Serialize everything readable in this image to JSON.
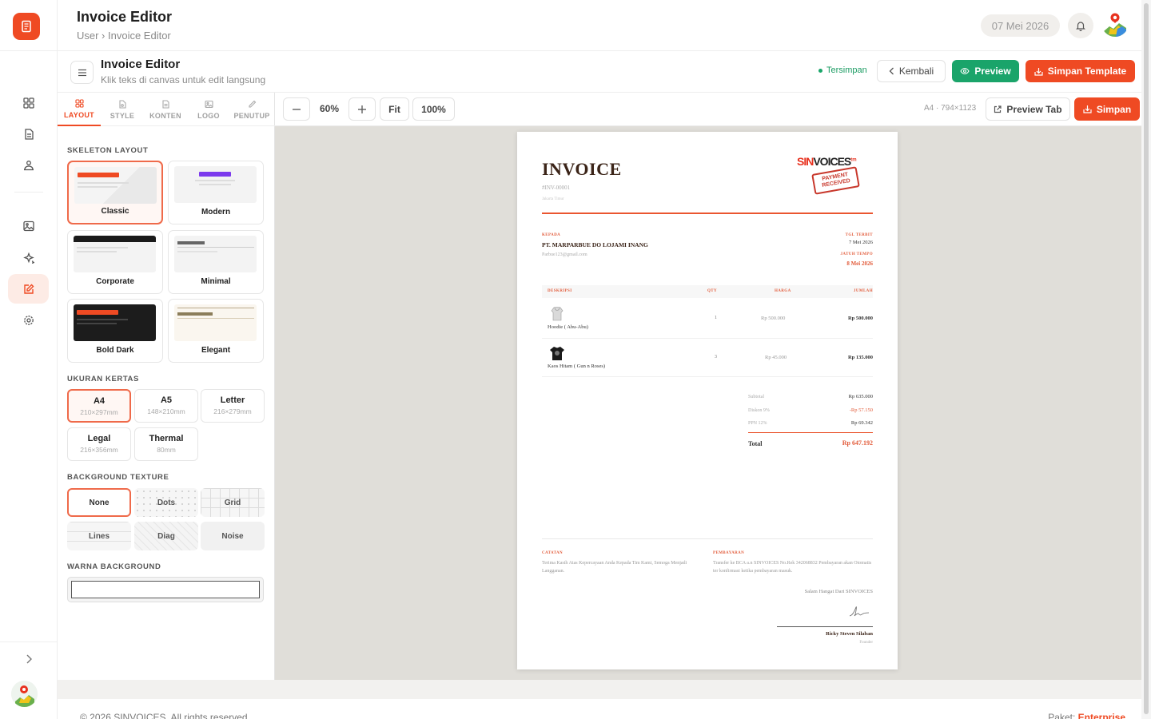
{
  "header": {
    "title": "Invoice Editor",
    "breadcrumb": "User › Invoice Editor",
    "date": "07 Mei 2026"
  },
  "editor": {
    "title": "Invoice Editor",
    "subtitle": "Klik teks di canvas untuk edit langsung",
    "saved_status": "Tersimpan",
    "back_label": "Kembali",
    "preview_label": "Preview",
    "save_template_label": "Simpan Template"
  },
  "tabs": [
    "LAYOUT",
    "STYLE",
    "KONTEN",
    "LOGO",
    "PENUTUP"
  ],
  "panel": {
    "skeleton_title": "SKELETON LAYOUT",
    "layouts": [
      "Classic",
      "Modern",
      "Corporate",
      "Minimal",
      "Bold Dark",
      "Elegant"
    ],
    "paper_title": "UKURAN KERTAS",
    "papers": [
      {
        "name": "A4",
        "size": "210×297mm"
      },
      {
        "name": "A5",
        "size": "148×210mm"
      },
      {
        "name": "Letter",
        "size": "216×279mm"
      },
      {
        "name": "Legal",
        "size": "216×356mm"
      },
      {
        "name": "Thermal",
        "size": "80mm"
      }
    ],
    "texture_title": "BACKGROUND TEXTURE",
    "textures": [
      "None",
      "Dots",
      "Grid",
      "Lines",
      "Diag",
      "Noise"
    ],
    "bgcolor_title": "WARNA BACKGROUND"
  },
  "canvas_toolbar": {
    "zoom": "60%",
    "fit_label": "Fit",
    "reset_label": "100%",
    "dimension": "A4 · 794×1123",
    "preview_tab_label": "Preview Tab",
    "save_label": "Simpan"
  },
  "invoice": {
    "title": "INVOICE",
    "number": "#INV-00001",
    "location": "Jakarta Timur",
    "brand_sin": "SIN",
    "brand_voices": "VOICES",
    "brand_tm": "tm",
    "stamp_line1": "PAYMENT",
    "stamp_line2": "RECEIVED",
    "to_label": "KEPADA",
    "to_name": "PT. MARPARBUE DO LOJAMI INANG",
    "to_email": "Parbue123@gmail.com",
    "issue_label": "TGL TERBIT",
    "issue_date": "7 Mei 2026",
    "due_label": "JATUH TEMPO",
    "due_date": "8 Mei 2026",
    "columns": [
      "DESKRIPSI",
      "QTY",
      "HARGA",
      "JUMLAH"
    ],
    "items": [
      {
        "desc": "Hoodie ( Abu-Abu)",
        "qty": "1",
        "price": "Rp 500.000",
        "total": "Rp 500.000"
      },
      {
        "desc": "Kaos Hitam ( Gun n Roses)",
        "qty": "3",
        "price": "Rp 45.000",
        "total": "Rp 135.000"
      }
    ],
    "subtotal_label": "Subtotal",
    "subtotal": "Rp 635.000",
    "discount_label": "Diskon 9%",
    "discount": "-Rp 57.150",
    "tax_label": "PPN 12%",
    "tax": "Rp 69.342",
    "total_label": "Total",
    "total": "Rp 647.192",
    "notes_label": "CATATAN",
    "notes": "Terima Kasih Atas Kepercayaan Anda Kepada Tim Kami, Semoga Menjadi Langganan.",
    "payment_label": "PEMBAYARAN",
    "payment": "Transfer ke BCA a.n SINVOICES No.Rek 342068832 Pembayaran akan Otomatis ter konfirmasi ketika pembayaran masuk.",
    "greeting": "Salam Hangat Dari SINVOICES",
    "signer": "Ricky Steven Silaban",
    "signer_role": "Founder"
  },
  "footer": {
    "copyright": "© 2026 SINVOICES. All rights reserved.",
    "plan_label": "Paket:",
    "plan": "Enterprise"
  },
  "colors": {
    "accent": "#ef4a23",
    "success": "#1aa46a",
    "canvas": "#e0ded9"
  }
}
